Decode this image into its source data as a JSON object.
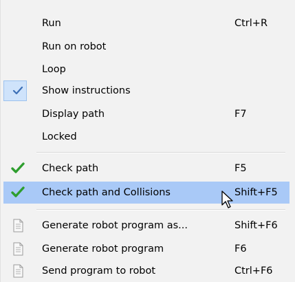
{
  "menu": {
    "items": [
      {
        "label": "Run",
        "shortcut": "Ctrl+R",
        "icon": "none"
      },
      {
        "label": "Run on robot",
        "shortcut": "",
        "icon": "none"
      },
      {
        "label": "Loop",
        "shortcut": "",
        "icon": "none"
      },
      {
        "label": "Show instructions",
        "shortcut": "",
        "icon": "checkmark-icon",
        "checked": true
      },
      {
        "label": "Display path",
        "shortcut": "F7",
        "icon": "none"
      },
      {
        "label": "Locked",
        "shortcut": "",
        "icon": "none"
      },
      {
        "label": "Check path",
        "shortcut": "F5",
        "icon": "green-check-icon"
      },
      {
        "label": "Check path and Collisions",
        "shortcut": "Shift+F5",
        "icon": "green-check-icon",
        "highlighted": true
      },
      {
        "label": "Generate robot program as...",
        "shortcut": "Shift+F6",
        "icon": "document-icon"
      },
      {
        "label": "Generate robot program",
        "shortcut": "F6",
        "icon": "document-icon"
      },
      {
        "label": "Send program to robot",
        "shortcut": "Ctrl+F6",
        "icon": "document-icon"
      }
    ]
  },
  "colors": {
    "menu_background": "#f2f2f2",
    "highlight": "#a9c9f7",
    "checked_box": "#cfe3fb",
    "check_green": "#2e9e2e",
    "check_blue": "#3c6fb6"
  }
}
